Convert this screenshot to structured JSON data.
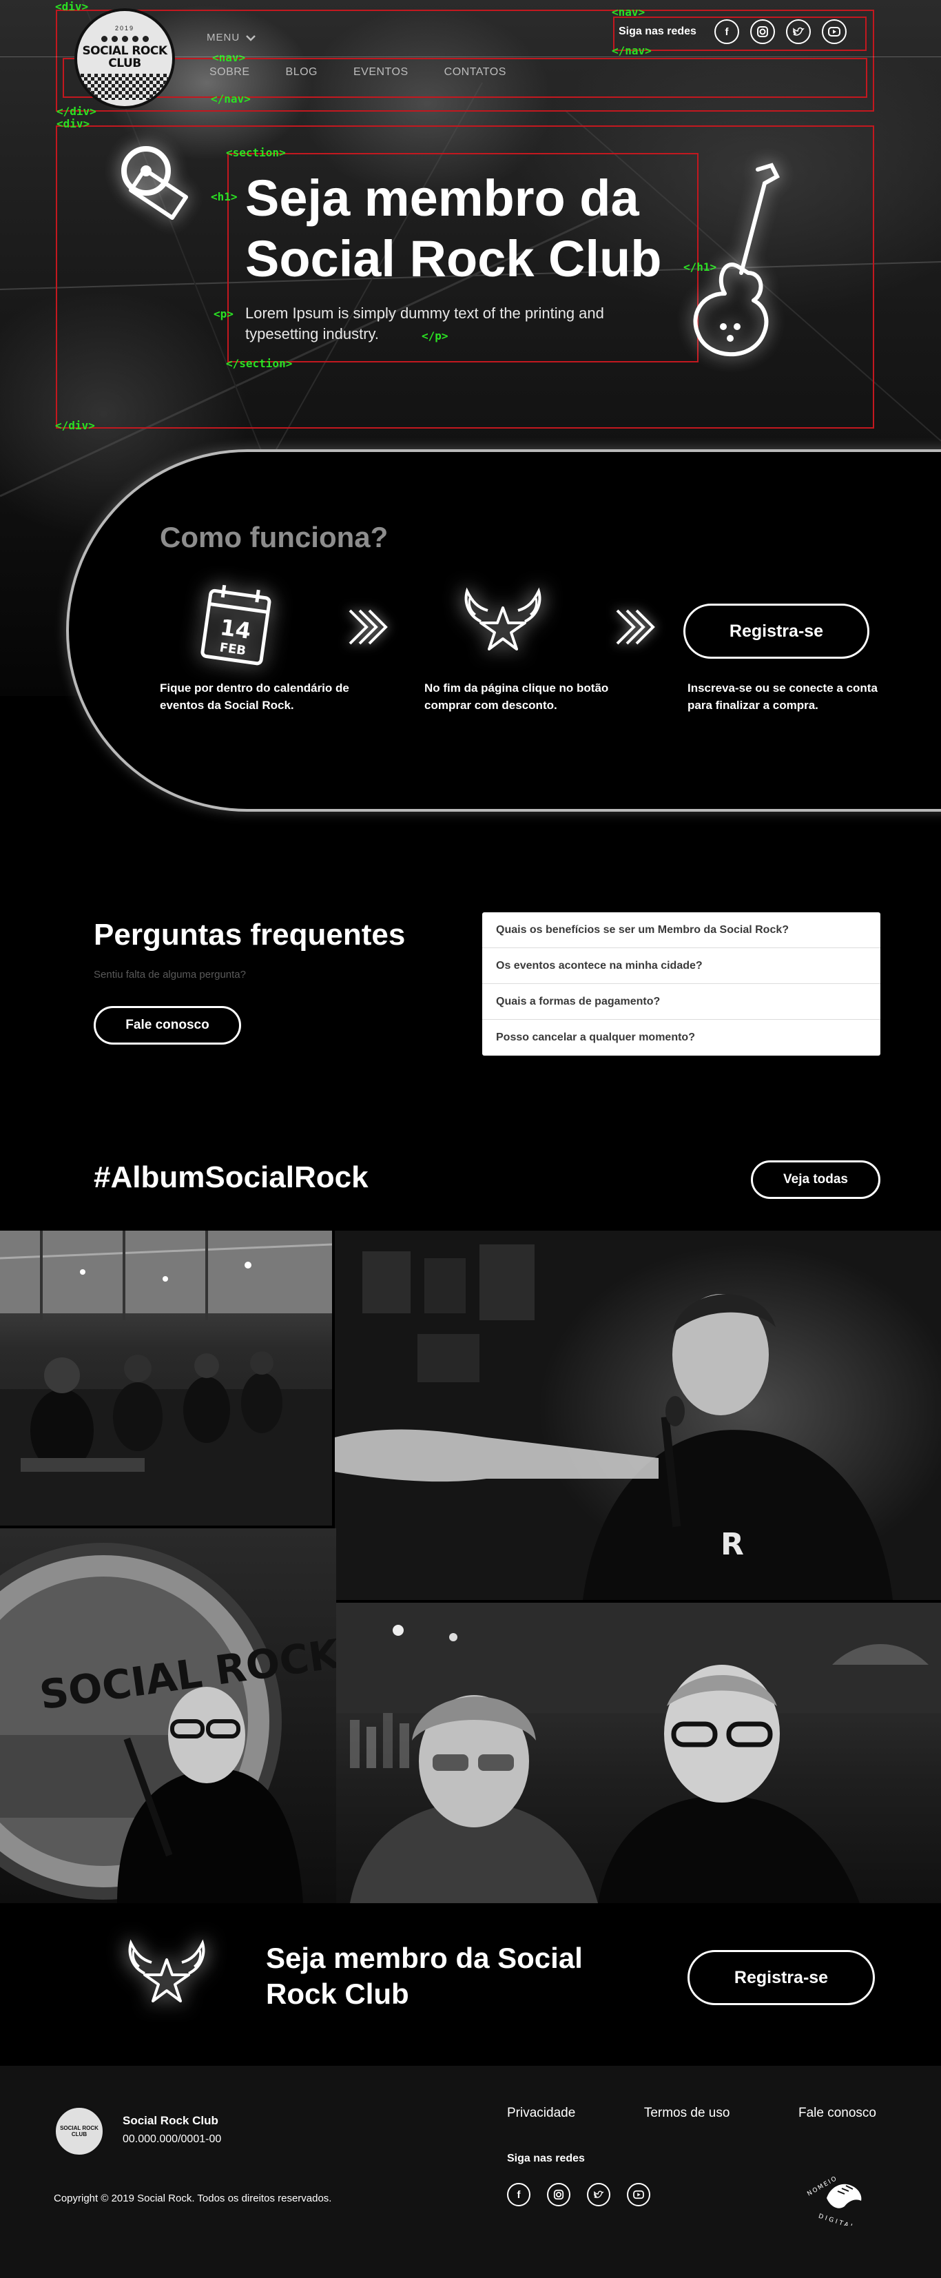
{
  "header": {
    "menu_label": "MENU",
    "nav": [
      "SOBRE",
      "BLOG",
      "EVENTOS",
      "CONTATOS"
    ],
    "social_label": "Siga nas redes",
    "social_icons": [
      "facebook-icon",
      "instagram-icon",
      "twitter-icon",
      "youtube-icon"
    ]
  },
  "logo": {
    "year": "2019",
    "name": "SOCIAL ROCK CLUB"
  },
  "annotations": {
    "div_open": "<div>",
    "div_close": "</div>",
    "nav_open": "<nav>",
    "nav_close": "</nav>",
    "section_open": "<section>",
    "section_close": "</section>",
    "h1_open": "<h1>",
    "h1_close": "</h1>",
    "p_open": "<p>",
    "p_close": "</p>"
  },
  "hero": {
    "title": "Seja membro da Social Rock Club",
    "text": "Lorem Ipsum is simply dummy text of the printing and typesetting industry."
  },
  "how": {
    "title": "Como funciona?",
    "calendar_day": "14",
    "calendar_month": "FEB",
    "steps": [
      "Fique por dentro do calendário de eventos da Social Rock.",
      "No fim da página clique no botão comprar com desconto.",
      "Inscreva-se ou se conecte a conta para finalizar a compra."
    ],
    "button": "Registra-se"
  },
  "faq": {
    "title": "Perguntas frequentes",
    "subtitle": "Sentiu falta de alguma pergunta?",
    "button": "Fale conosco",
    "items": [
      "Quais os benefícios se ser um Membro da Social Rock?",
      "Os eventos acontece na minha cidade?",
      "Quais a formas de pagamento?",
      "Posso cancelar a qualquer momento?"
    ]
  },
  "album": {
    "title": "#AlbumSocialRock",
    "button": "Veja todas"
  },
  "cta": {
    "title": "Seja membro da Social Rock Club",
    "button": "Registra-se"
  },
  "footer": {
    "logo_text": "SOCIAL ROCK CLUB",
    "name": "Social Rock Club",
    "cnpj": "00.000.000/0001-00",
    "links": [
      "Privacidade",
      "Termos de uso",
      "Fale conosco"
    ],
    "social_label": "Siga nas redes",
    "copyright": "Copyright © 2019 Social Rock. Todos os direitos reservados.",
    "studio_top": "NOMEIO",
    "studio_bottom": "DIGITAL"
  }
}
